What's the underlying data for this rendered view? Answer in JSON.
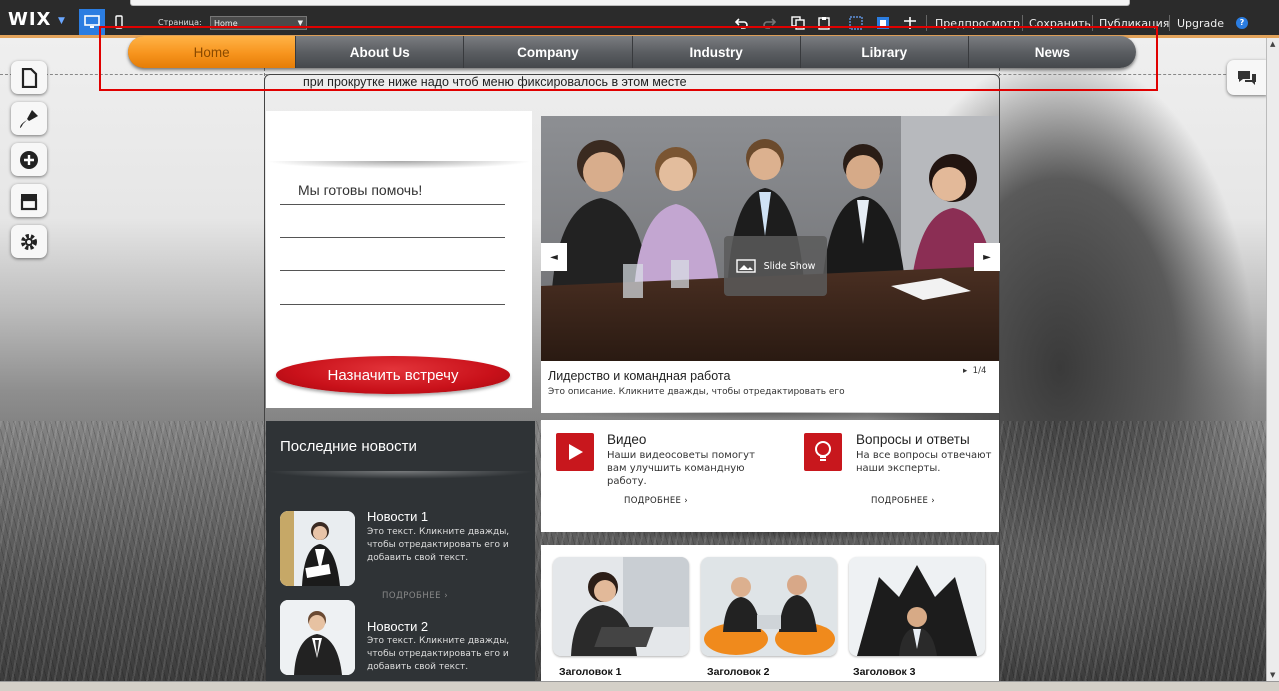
{
  "editor": {
    "logo": "WIX",
    "page_label": "Страница:",
    "page_value": "Home",
    "links": [
      "Предпросмотр",
      "Сохранить",
      "Публикация",
      "Upgrade"
    ],
    "help": "?"
  },
  "menu": {
    "items": [
      "Home",
      "About Us",
      "Company",
      "Industry",
      "Library",
      "News"
    ],
    "active": "Home"
  },
  "note": "при прокрутке ниже надо чтоб меню фиксировалось в этом месте",
  "help_card": {
    "title": "Мы готовы помочь!",
    "button": "Назначить встречу"
  },
  "news": {
    "heading": "Последние новости",
    "items": [
      {
        "title": "Новости 1",
        "text": "Это текст. Кликните дважды, чтобы отредактировать его и добавить свой текст.",
        "more": "ПОДРОБНЕЕ ›"
      },
      {
        "title": "Новости 2",
        "text": "Это текст. Кликните дважды, чтобы отредактировать его и добавить свой текст.",
        "more": ""
      }
    ]
  },
  "slideshow": {
    "badge": "Slide Show",
    "caption": "Лидерство и командная работа",
    "description": "Это описание. Кликните дважды, чтобы отредактировать его",
    "counter": "1/4"
  },
  "features": [
    {
      "title": "Видео",
      "text": "Наши видеосоветы помогут вам улучшить командную работу.",
      "more": "ПОДРОБНЕЕ ›",
      "icon": "play-icon"
    },
    {
      "title": "Вопросы и ответы",
      "text": "На все вопросы отвечают наши эксперты.",
      "more": "ПОДРОБНЕЕ ›",
      "icon": "lightbulb-icon"
    }
  ],
  "gallery": [
    "Заголовок 1",
    "Заголовок 2",
    "Заголовок 3"
  ],
  "colors": {
    "accent_orange": "#f7941d",
    "cta_red": "#c9111a",
    "editor_blue": "#2b7de1",
    "highlight_red": "#e00000"
  }
}
